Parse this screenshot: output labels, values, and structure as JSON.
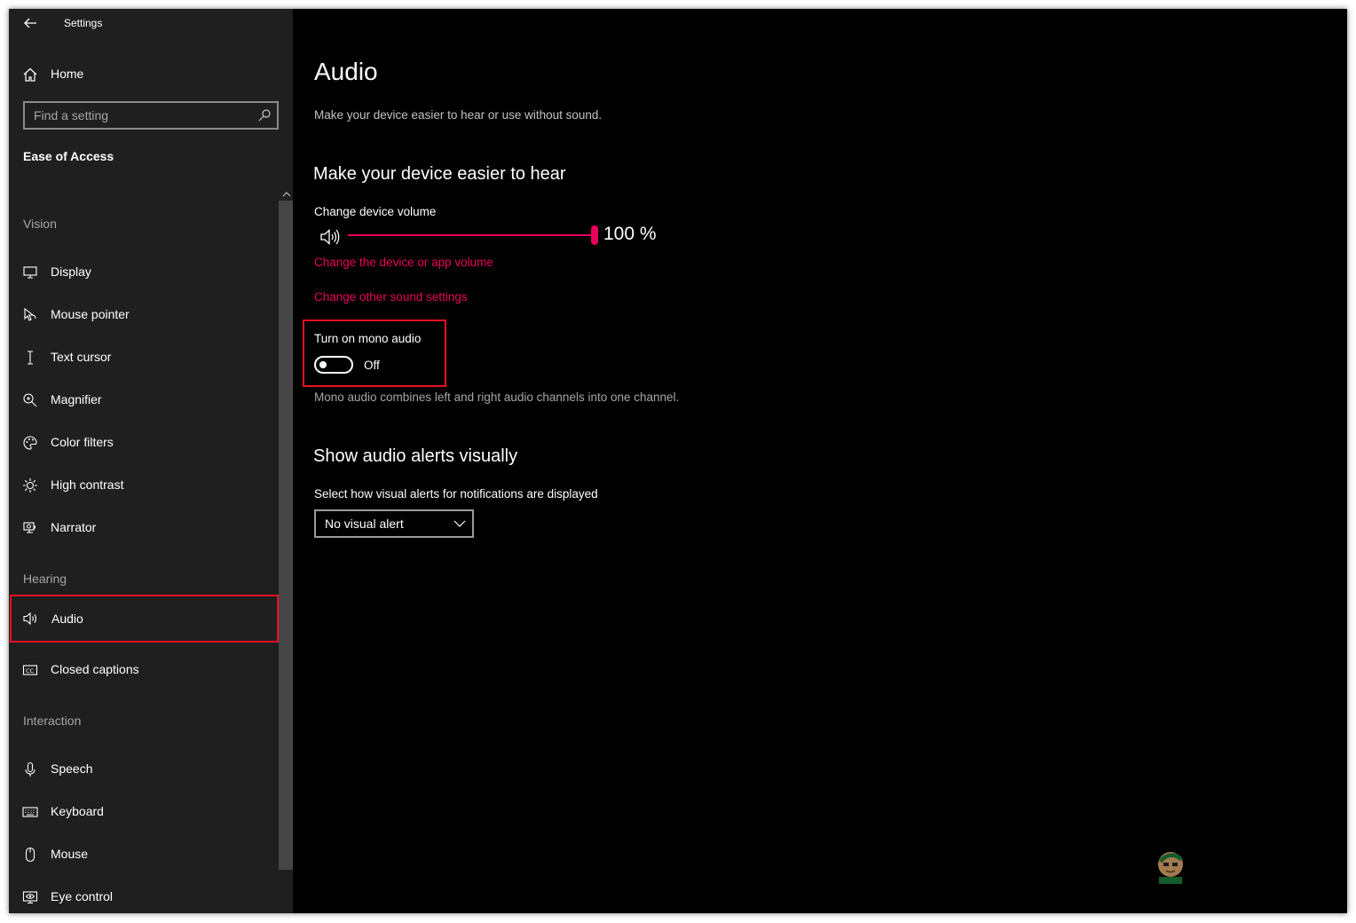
{
  "window": {
    "title": "Settings"
  },
  "sidebar": {
    "home_label": "Home",
    "search_placeholder": "Find a setting",
    "category_title": "Ease of Access",
    "sections": [
      {
        "header": "Vision",
        "items": [
          {
            "label": "Display",
            "icon": "display-icon"
          },
          {
            "label": "Mouse pointer",
            "icon": "mouse-pointer-icon"
          },
          {
            "label": "Text cursor",
            "icon": "text-cursor-icon"
          },
          {
            "label": "Magnifier",
            "icon": "magnifier-icon"
          },
          {
            "label": "Color filters",
            "icon": "color-filters-icon"
          },
          {
            "label": "High contrast",
            "icon": "high-contrast-icon"
          },
          {
            "label": "Narrator",
            "icon": "narrator-icon"
          }
        ]
      },
      {
        "header": "Hearing",
        "items": [
          {
            "label": "Audio",
            "icon": "speaker-icon",
            "selected": true
          },
          {
            "label": "Closed captions",
            "icon": "closed-captions-icon"
          }
        ]
      },
      {
        "header": "Interaction",
        "items": [
          {
            "label": "Speech",
            "icon": "microphone-icon"
          },
          {
            "label": "Keyboard",
            "icon": "keyboard-icon"
          },
          {
            "label": "Mouse",
            "icon": "mouse-icon"
          },
          {
            "label": "Eye control",
            "icon": "eye-control-icon"
          }
        ]
      }
    ]
  },
  "main": {
    "title": "Audio",
    "subtitle": "Make your device easier to hear or use without sound.",
    "hear_section": {
      "heading": "Make your device easier to hear",
      "volume_label": "Change device volume",
      "volume_value": 100,
      "volume_text": "100 %",
      "link_app_volume": "Change the device or app volume",
      "link_sound_settings": "Change other sound settings",
      "mono_label": "Turn on mono audio",
      "mono_state": "Off",
      "mono_description": "Mono audio combines left and right audio channels into one channel."
    },
    "alerts_section": {
      "heading": "Show audio alerts visually",
      "select_label": "Select how visual alerts for notifications are displayed",
      "select_value": "No visual alert"
    }
  },
  "colors": {
    "accent": "#ea005e",
    "highlight_box": "#e81123",
    "sidebar_bg": "#1f1f1f",
    "main_bg": "#000000"
  }
}
